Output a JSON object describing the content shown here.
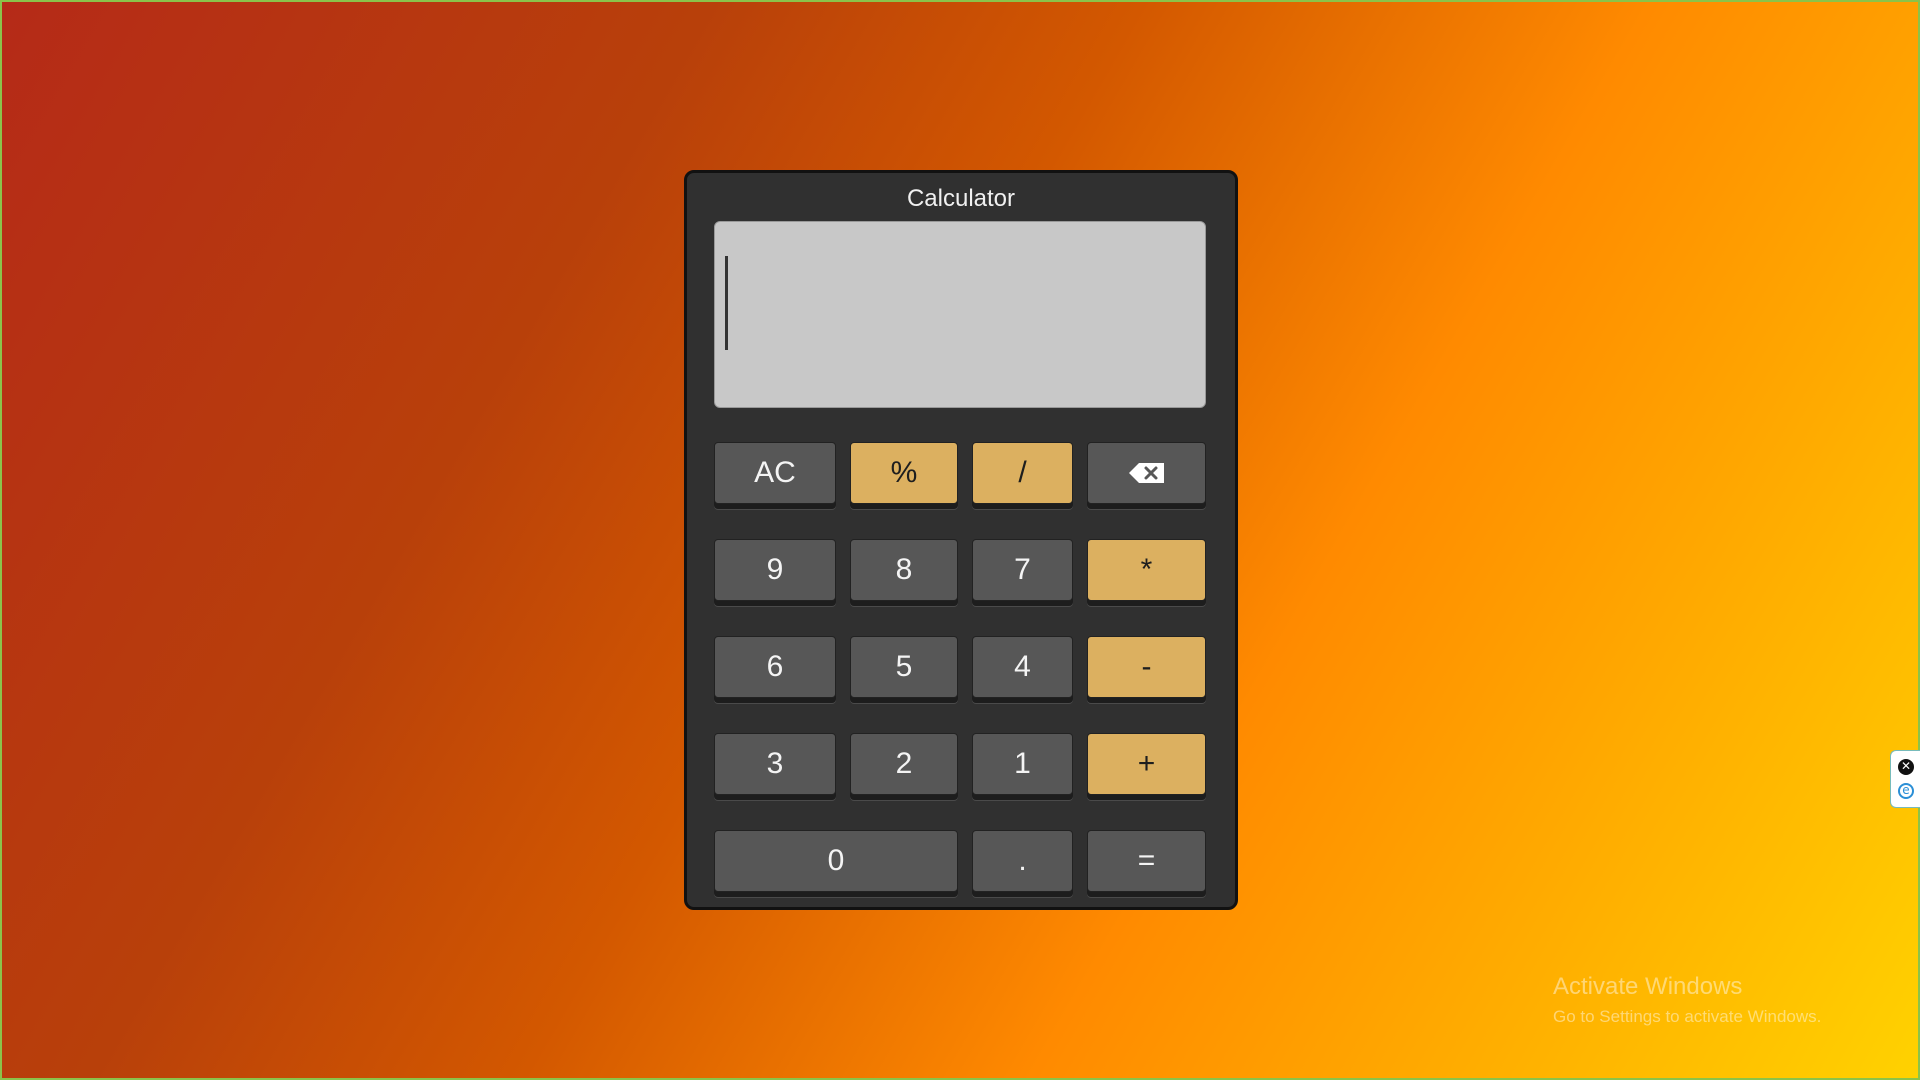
{
  "calculator": {
    "title": "Calculator",
    "display_value": "",
    "buttons": [
      {
        "label": "AC",
        "name": "all-clear-button"
      },
      {
        "label": "%",
        "name": "percent-button"
      },
      {
        "label": "/",
        "name": "divide-button"
      },
      {
        "label": "",
        "name": "backspace-button",
        "icon": "backspace-icon"
      },
      {
        "label": "9",
        "name": "digit-9-button"
      },
      {
        "label": "8",
        "name": "digit-8-button"
      },
      {
        "label": "7",
        "name": "digit-7-button"
      },
      {
        "label": "*",
        "name": "multiply-button"
      },
      {
        "label": "6",
        "name": "digit-6-button"
      },
      {
        "label": "5",
        "name": "digit-5-button"
      },
      {
        "label": "4",
        "name": "digit-4-button"
      },
      {
        "label": "-",
        "name": "subtract-button"
      },
      {
        "label": "3",
        "name": "digit-3-button"
      },
      {
        "label": "2",
        "name": "digit-2-button"
      },
      {
        "label": "1",
        "name": "digit-1-button"
      },
      {
        "label": "+",
        "name": "add-button"
      },
      {
        "label": "0",
        "name": "digit-0-button"
      },
      {
        "label": ".",
        "name": "decimal-button"
      },
      {
        "label": "=",
        "name": "equals-button"
      }
    ]
  },
  "watermark": {
    "line1": "Activate Windows",
    "line2": "Go to Settings to activate Windows."
  },
  "side_widget": {
    "close_icon": "close-icon",
    "extension_icon": "e-icon"
  },
  "colors": {
    "panel": "#303030",
    "display": "#c8c8c8",
    "key": "#575757",
    "operator_key": "#dcb060",
    "frame_border": "#8bc34a"
  }
}
